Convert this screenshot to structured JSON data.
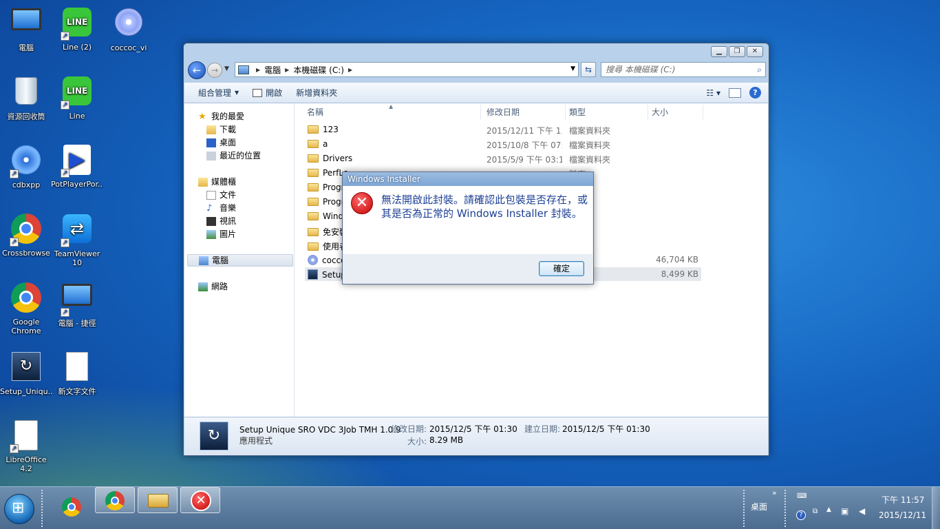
{
  "desktop": {
    "icons": [
      {
        "label": "電腦",
        "icon": "computer-icon"
      },
      {
        "label": "Line (2)",
        "icon": "line-icon"
      },
      {
        "label": "coccoc_vi",
        "icon": "installer-disc-icon"
      },
      {
        "label": "資源回收筒",
        "icon": "recycle-bin-icon"
      },
      {
        "label": "Line",
        "icon": "line-icon"
      },
      {
        "label": "cdbxpp",
        "icon": "cd-burner-icon"
      },
      {
        "label": "PotPlayerPor...",
        "icon": "potplayer-icon"
      },
      {
        "label": "Crossbrowse",
        "icon": "chrome-icon"
      },
      {
        "label": "TeamViewer 10",
        "icon": "teamviewer-icon"
      },
      {
        "label": "Google Chrome",
        "icon": "chrome-icon"
      },
      {
        "label": "電腦 - 捷徑",
        "icon": "computer-icon"
      },
      {
        "label": "Setup_Uniqu...",
        "icon": "setup-icon"
      },
      {
        "label": "新文字文件",
        "icon": "text-document-icon"
      },
      {
        "label": "LibreOffice 4.2",
        "icon": "libreoffice-icon"
      }
    ]
  },
  "explorer": {
    "address": {
      "segments": [
        "電腦",
        "本機磁碟 (C:)"
      ]
    },
    "search": {
      "placeholder": "搜尋 本機磁碟 (C:)"
    },
    "toolbar": {
      "organize": "組合管理",
      "open": "開啟",
      "new_folder": "新增資料夾"
    },
    "nav": {
      "favorites": "我的最愛",
      "downloads": "下載",
      "desktop": "桌面",
      "recent": "最近的位置",
      "libraries": "媒體櫃",
      "documents": "文件",
      "music": "音樂",
      "videos": "視訊",
      "pictures": "圖片",
      "computer": "電腦",
      "network": "網路"
    },
    "columns": {
      "name": "名稱",
      "modified": "修改日期",
      "type": "類型",
      "size": "大小"
    },
    "files": [
      {
        "name": "123",
        "modified": "2015/12/11 下午 1...",
        "type": "檔案資料夾",
        "size": "",
        "icon": "folder-icon"
      },
      {
        "name": "a",
        "modified": "2015/10/8 下午 07:...",
        "type": "檔案資料夾",
        "size": "",
        "icon": "folder-icon"
      },
      {
        "name": "Drivers",
        "modified": "2015/5/9 下午 03:14",
        "type": "檔案資料夾",
        "size": "",
        "icon": "folder-icon"
      },
      {
        "name": "PerfLo",
        "modified": "",
        "type": "料夾",
        "size": "",
        "icon": "folder-icon"
      },
      {
        "name": "Progra",
        "modified": "",
        "type": "料夾",
        "size": "",
        "icon": "folder-icon"
      },
      {
        "name": "Progra",
        "modified": "",
        "type": "料夾",
        "size": "",
        "icon": "folder-icon"
      },
      {
        "name": "Windo",
        "modified": "",
        "type": "料夾",
        "size": "",
        "icon": "folder-icon"
      },
      {
        "name": "免安裝",
        "modified": "",
        "type": "料夾",
        "size": "",
        "icon": "folder-icon"
      },
      {
        "name": "使用者",
        "modified": "",
        "type": "料夾",
        "size": "",
        "icon": "folder-icon"
      },
      {
        "name": "coccoc",
        "modified": "",
        "type": "式",
        "size": "46,704 KB",
        "icon": "installer-disc-icon"
      },
      {
        "name": "Setup_",
        "modified": "",
        "type": "式",
        "size": "8,499 KB",
        "icon": "setup-icon"
      }
    ],
    "details": {
      "name": "Setup Unique SRO VDC 3Job TMH 1.0.9",
      "type": "應用程式",
      "modified_label": "修改日期:",
      "modified_value": "2015/12/5 下午 01:30",
      "size_label": "大小:",
      "size_value": "8.29 MB",
      "created_label": "建立日期:",
      "created_value": "2015/12/5 下午 01:30"
    }
  },
  "dialog": {
    "title": "Windows Installer",
    "message": "無法開啟此封裝。請確認此包裝是否存在，或其是否為正常的 Windows Installer 封裝。",
    "ok_label": "確定"
  },
  "taskbar": {
    "tray_desktop_label": "桌面",
    "clock_time": "下午 11:57",
    "clock_date": "2015/12/11"
  }
}
